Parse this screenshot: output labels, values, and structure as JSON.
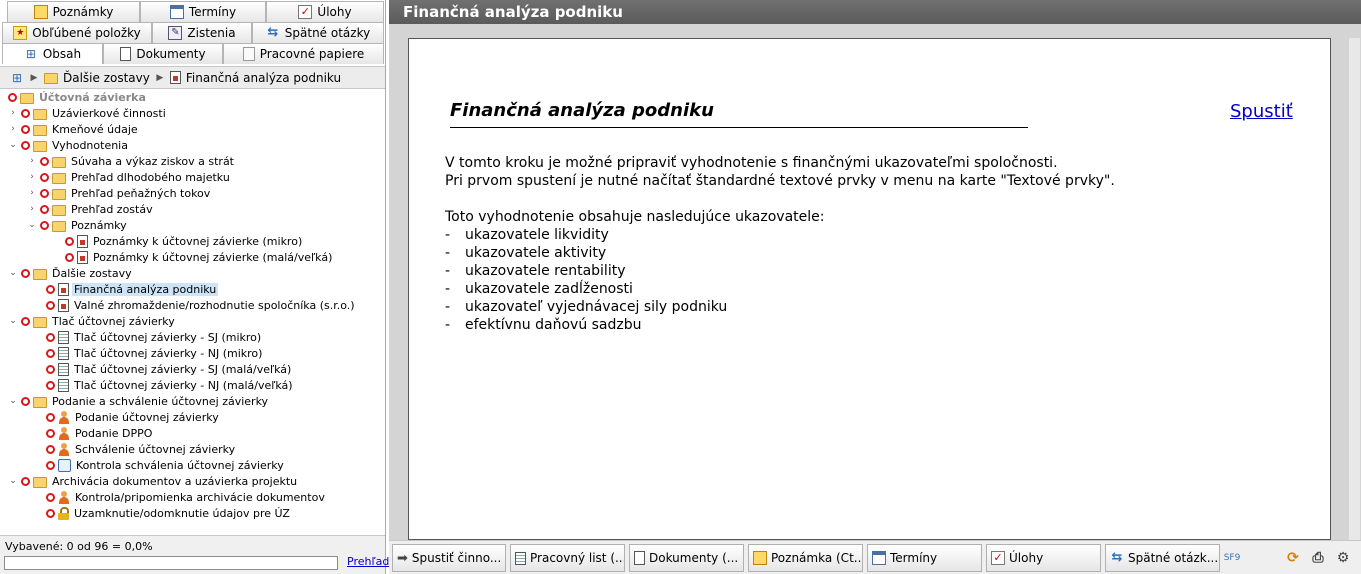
{
  "tabs": {
    "row1": [
      "Poznámky",
      "Termíny",
      "Úlohy"
    ],
    "row2": [
      "Obľúbené položky",
      "Zistenia",
      "Spätné otázky"
    ],
    "row3": [
      "Obsah",
      "Dokumenty",
      "Pracovné papiere"
    ]
  },
  "breadcrumb": {
    "item1": "Ďalšie zostavy",
    "item2": "Finančná analýza podniku"
  },
  "tree": {
    "root": "Účtovná závierka",
    "n1": "Uzávierkové činnosti",
    "n2": "Kmeňové údaje",
    "n3": "Vyhodnotenia",
    "n3a": "Súvaha a výkaz ziskov a strát",
    "n3b": "Prehľad dlhodobého majetku",
    "n3c": "Prehľad peňažných tokov",
    "n3d": "Prehľad zostáv",
    "n3e": "Poznámky",
    "n3e1": "Poznámky k účtovnej závierke (mikro)",
    "n3e2": "Poznámky k účtovnej závierke (malá/veľká)",
    "n4": "Ďalšie zostavy",
    "n4a": "Finančná analýza podniku",
    "n4b": "Valné zhromaždenie/rozhodnutie spoločníka (s.r.o.)",
    "n5": "Tlač účtovnej závierky",
    "n5a": "Tlač účtovnej závierky - SJ (mikro)",
    "n5b": "Tlač účtovnej závierky - NJ (mikro)",
    "n5c": "Tlač účtovnej závierky - SJ (malá/veľká)",
    "n5d": "Tlač účtovnej závierky - NJ (malá/veľká)",
    "n6": "Podanie a schválenie účtovnej závierky",
    "n6a": "Podanie účtovnej závierky",
    "n6b": "Podanie DPPO",
    "n6c": "Schválenie účtovnej závierky",
    "n6d": "Kontrola schválenia účtovnej závierky",
    "n7": "Archivácia dokumentov a uzávierka projektu",
    "n7a": "Kontrola/pripomienka archivácie dokumentov",
    "n7b": "Uzamknutie/odomknutie údajov pre ÚZ"
  },
  "footer": {
    "progress": "Vybavené: 0 od 96 = 0,0%",
    "progress_fraction": 0,
    "link": "Prehľad"
  },
  "main": {
    "title": "Finančná analýza podniku",
    "heading": "Finančná analýza podniku",
    "run_link": "Spustiť",
    "p1": "V tomto kroku je možné pripraviť vyhodnotenie s finančnými ukazovateľmi spoločnosti.",
    "p2": "Pri prvom spustení je nutné načítať štandardné textové prvky v menu na karte \"Textové prvky\".",
    "p3": "Toto vyhodnotenie obsahuje nasledujúce ukazovatele:",
    "dash": "-",
    "bullets": [
      "ukazovatele likvidity",
      "ukazovatele aktivity",
      "ukazovatele rentability",
      "ukazovatele zadĺženosti",
      "ukazovateľ vyjednávacej sily podniku",
      "efektívnu daňovú sadzbu"
    ]
  },
  "taskbar": {
    "b1": "Spustiť činno...",
    "b2": "Pracovný list (...",
    "b3": "Dokumenty (...",
    "b4": "Poznámka (Ct...",
    "b5": "Termíny",
    "b6": "Úlohy",
    "b7": "Spätné otázk...",
    "sf9": "SF9"
  },
  "colors": {
    "status_ring": "#d11a1a",
    "selected_bg": "#cde4f7",
    "header_bg": "#5a5a5a",
    "link": "#0000cc",
    "folder": "#f9d46c"
  }
}
